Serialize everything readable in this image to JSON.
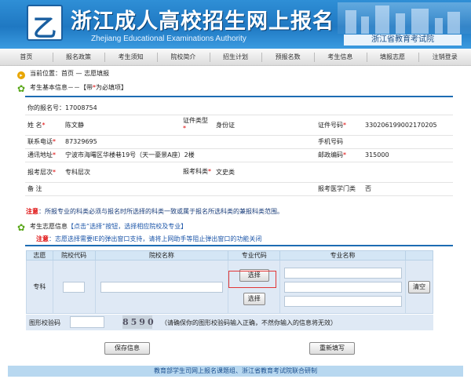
{
  "header": {
    "title": "浙江成人高校招生网上报名",
    "subtitle": "Zhejiang Educational Examinations Authority",
    "authority": "浙江省教育考试院",
    "logo_letter": "乙"
  },
  "nav": [
    "首页",
    "报名政策",
    "考生须知",
    "院校简介",
    "招生计划",
    "预报名数",
    "考生信息",
    "填报志愿",
    "注销登录"
  ],
  "crumb": {
    "prefix": "当前位置：首页 — ",
    "current": "志愿填报"
  },
  "basic": {
    "title": "考生基本信息－－【带",
    "star": "*",
    "title_tail": "为必填项】"
  },
  "info": {
    "regno_label": "你的报名号：",
    "regno": "17008754",
    "name_label": "姓  名",
    "name": "陈文静",
    "idtype_label": "证件类型",
    "idtype": "身份证",
    "idno_label": "证件号码",
    "idno": "330206199002170205",
    "phone_label": "联系电话",
    "phone": "87329695",
    "mobile_label": "手机号码",
    "mobile": "",
    "address_label": "通讯地址",
    "address": "宁波市海曙区华楼巷19号（天一豪景A座）2楼",
    "postcode_label": "邮政编码",
    "postcode": "315000",
    "level_label": "报考层次",
    "level": "专科层次",
    "subject_label": "报考科类",
    "subject": "文史类",
    "remark_label": "备  注",
    "remark": "",
    "medical_label": "报考医学门类",
    "medical": "否"
  },
  "notes": {
    "note1_prefix": "注意",
    "note1": "：所报专业的科类必须与报名时所选择的科类一致或属于报名所选科类的兼报科类范围。",
    "wish_title_a": "考生志愿信息",
    "wish_title_b": "【点击“选择”按钮，选择相应院校及专业】",
    "note2_prefix": "注意",
    "note2": "：志愿选择需要IE的弹出窗口支持，请将上网助手等阻止弹出窗口的功能关闭"
  },
  "choice": {
    "headers": [
      "志愿",
      "院校代码",
      "院校名称",
      "专业代码",
      "专业名称"
    ],
    "row_label": "专科",
    "select_label": "选择",
    "clear_label": "清空"
  },
  "captcha": {
    "label": "图形校验码",
    "value": "",
    "image_text": "8590",
    "hint": "（请确保你的图形校验码输入正确，不然你输入的信息将无效）"
  },
  "actions": {
    "save": "保存信息",
    "reset": "重新填写"
  },
  "footer": "教育部学生司网上报名课题组、浙江省教育考试院联合研制",
  "colors": {
    "banner": "#1f78c2",
    "accent_red": "#dd0000",
    "rule": "#1d6cb3",
    "table_bg": "#dfe9f5"
  }
}
